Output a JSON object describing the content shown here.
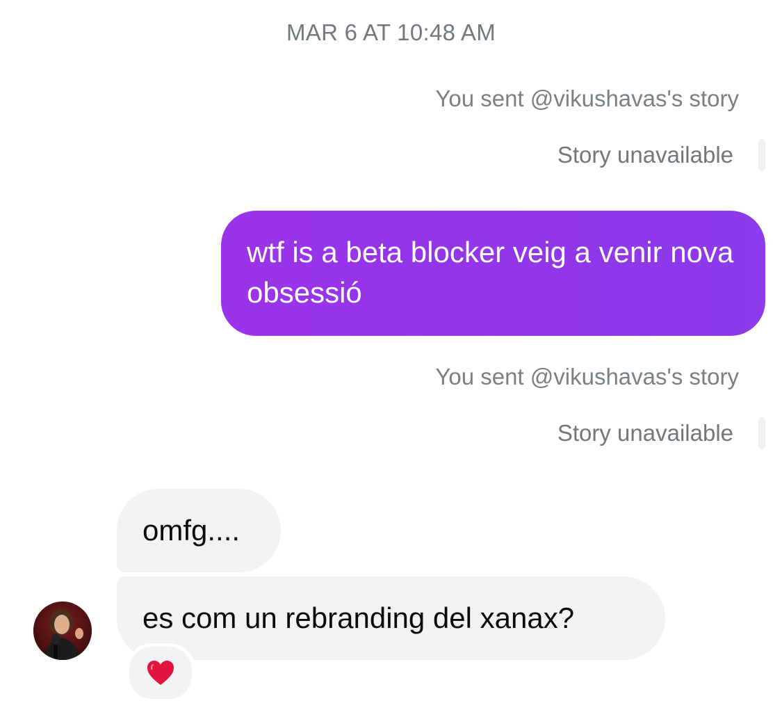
{
  "thread": {
    "timestamp": "MAR 6 AT 10:48 AM",
    "messages": [
      {
        "kind": "story_share",
        "note": "You sent @vikushavas's story",
        "status": "Story unavailable"
      },
      {
        "kind": "outgoing",
        "text": "wtf is a beta blocker veig a venir nova obsessió"
      },
      {
        "kind": "story_share",
        "note": "You sent @vikushavas's story",
        "status": "Story unavailable"
      },
      {
        "kind": "incoming",
        "text": "omfg...."
      },
      {
        "kind": "incoming",
        "text": "es com un rebranding del xanax?",
        "reaction": "heart-icon"
      }
    ]
  },
  "colors": {
    "outgoing_bubble": "#9333ea",
    "incoming_bubble": "#f2f2f4",
    "meta_text": "#7a7e85",
    "heart": "#e0143c"
  }
}
